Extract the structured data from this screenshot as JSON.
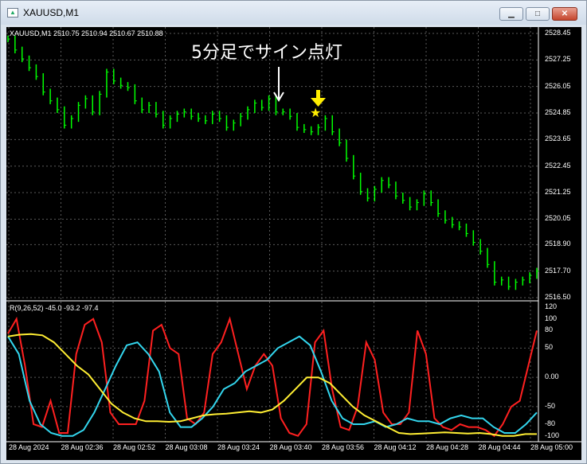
{
  "window": {
    "title": "XAUUSD,M1",
    "minimize_icon": "minimize-icon",
    "maximize_icon": "maximize-icon",
    "close_icon": "close-icon"
  },
  "chart": {
    "symbol_line": "XAUUSD,M1  2510.75 2510.94 2510.67 2510.88",
    "annotation": "5分足でサイン点灯",
    "price_axis": [
      "2528.45",
      "2527.25",
      "2526.05",
      "2524.85",
      "2523.65",
      "2522.45",
      "2521.25",
      "2520.05",
      "2518.90",
      "2517.70",
      "2516.50"
    ],
    "time_axis": [
      "28 Aug 2024",
      "28 Aug 02:36",
      "28 Aug 02:52",
      "28 Aug 03:08",
      "28 Aug 03:24",
      "28 Aug 03:40",
      "28 Aug 03:56",
      "28 Aug 04:12",
      "28 Aug 04:28",
      "28 Aug 04:44",
      "28 Aug 05:00"
    ],
    "indicator_line": "R(9,26,52) -45.0 -93.2 -97.4",
    "indicator_axis": [
      "120",
      "100",
      "80",
      "50",
      "0.00",
      "-50",
      "-80",
      "-100"
    ],
    "colors": {
      "candles": "#00ff00",
      "star": "#ffff00",
      "r9": "#ff2020",
      "r26": "#33d6ee",
      "r52": "#ffee33",
      "grid": "#ffffff"
    }
  },
  "chart_data": {
    "type": "line",
    "price_ylim": [
      2516.5,
      2528.45
    ],
    "price_close": [
      2528.2,
      2527.7,
      2527.3,
      2526.9,
      2526.5,
      2525.8,
      2525.4,
      2525.0,
      2524.3,
      2524.6,
      2525.2,
      2525.5,
      2524.9,
      2525.7,
      2526.7,
      2526.3,
      2526.1,
      2526.0,
      2525.4,
      2525.0,
      2525.2,
      2524.8,
      2524.3,
      2524.6,
      2524.8,
      2524.9,
      2524.7,
      2524.6,
      2524.5,
      2524.8,
      2524.6,
      2524.2,
      2524.4,
      2524.7,
      2525.0,
      2525.3,
      2525.1,
      2525.5,
      2524.9,
      2524.9,
      2524.7,
      2524.2,
      2524.1,
      2524.0,
      2524.2,
      2524.6,
      2524.0,
      2523.5,
      2522.8,
      2522.0,
      2521.3,
      2521.0,
      2521.4,
      2521.8,
      2521.6,
      2521.1,
      2520.9,
      2520.6,
      2520.8,
      2521.2,
      2520.8,
      2520.3,
      2520.0,
      2519.8,
      2519.7,
      2519.4,
      2519.0,
      2518.6,
      2518.0,
      2517.2,
      2517.3,
      2517.0,
      2517.2,
      2517.3,
      2517.5,
      2517.7
    ],
    "signal_index": 34,
    "indicator_ylim": [
      -110,
      120
    ],
    "series": [
      {
        "name": "R(9)",
        "values": [
          75,
          100,
          20,
          -80,
          -85,
          -40,
          -95,
          -95,
          40,
          90,
          100,
          60,
          -60,
          -80,
          -80,
          -80,
          -40,
          80,
          90,
          50,
          40,
          -70,
          -80,
          -60,
          40,
          60,
          100,
          40,
          -20,
          20,
          40,
          20,
          -70,
          -95,
          -100,
          -80,
          60,
          80,
          -20,
          -85,
          -90,
          -50,
          60,
          30,
          -60,
          -80,
          -80,
          -60,
          80,
          40,
          -70,
          -85,
          -90,
          -80,
          -85,
          -85,
          -90,
          -100,
          -80,
          -50,
          -40,
          20,
          80
        ]
      },
      {
        "name": "R(26)",
        "values": [
          70,
          40,
          -40,
          -80,
          -95,
          -100,
          -100,
          -90,
          -60,
          -20,
          20,
          55,
          60,
          40,
          10,
          -60,
          -85,
          -85,
          -70,
          -50,
          -20,
          -10,
          10,
          20,
          30,
          50,
          60,
          70,
          55,
          10,
          -40,
          -70,
          -80,
          -80,
          -75,
          -85,
          -80,
          -70,
          -75,
          -75,
          -80,
          -70,
          -65,
          -70,
          -70,
          -85,
          -95,
          -95,
          -80,
          -60
        ]
      },
      {
        "name": "R(52)",
        "values": [
          70,
          73,
          74,
          72,
          60,
          40,
          20,
          5,
          -20,
          -45,
          -60,
          -70,
          -75,
          -75,
          -76,
          -75,
          -70,
          -65,
          -63,
          -62,
          -60,
          -58,
          -60,
          -55,
          -40,
          -20,
          0,
          0,
          -10,
          -30,
          -50,
          -65,
          -75,
          -85,
          -95,
          -97,
          -96,
          -95,
          -94,
          -95,
          -96,
          -95,
          -97,
          -100,
          -100,
          -97,
          -97
        ]
      }
    ]
  }
}
